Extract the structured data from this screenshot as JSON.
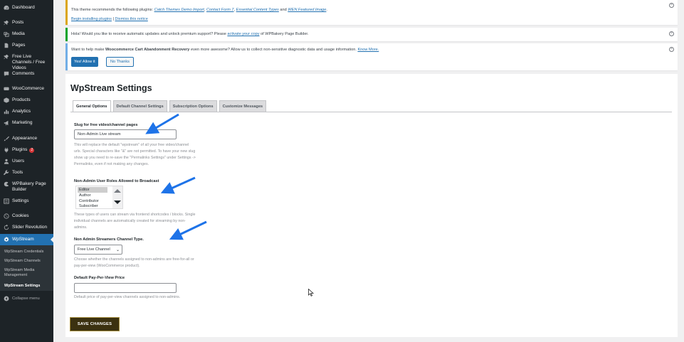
{
  "sidebar": {
    "items": [
      {
        "label": "Dashboard",
        "icon": "dashboard-icon"
      },
      {
        "label": "Posts",
        "icon": "pin-icon"
      },
      {
        "label": "Media",
        "icon": "media-icon"
      },
      {
        "label": "Pages",
        "icon": "page-icon"
      },
      {
        "label": "Free Live Channels / Free Videos",
        "icon": "pin-icon"
      },
      {
        "label": "Comments",
        "icon": "comment-icon"
      },
      {
        "label": "WooCommerce",
        "icon": "woocommerce-icon"
      },
      {
        "label": "Products",
        "icon": "box-icon"
      },
      {
        "label": "Analytics",
        "icon": "bar-chart-icon"
      },
      {
        "label": "Marketing",
        "icon": "megaphone-icon"
      },
      {
        "label": "Appearance",
        "icon": "brush-icon"
      },
      {
        "label": "Plugins",
        "icon": "plug-icon",
        "badge": "2"
      },
      {
        "label": "Users",
        "icon": "user-icon"
      },
      {
        "label": "Tools",
        "icon": "wrench-icon"
      },
      {
        "label": "WPBakery Page Builder",
        "icon": "bakery-icon"
      },
      {
        "label": "Settings",
        "icon": "settings-icon"
      },
      {
        "label": "Cookies",
        "icon": "cookie-icon"
      },
      {
        "label": "Slider Revolution",
        "icon": "refresh-icon"
      },
      {
        "label": "WpStream",
        "icon": "gear-icon"
      }
    ],
    "submenu": [
      {
        "label": "WpStream Credentials"
      },
      {
        "label": "WpStream Channels"
      },
      {
        "label": "WpStream Media Management"
      },
      {
        "label": "WpStream Settings"
      }
    ],
    "collapse_label": "Collapse menu"
  },
  "notices": {
    "theme": {
      "text_before": "This theme recommends the following plugins: ",
      "plugin_1": "Catch Themes Demo Import",
      "sep_1": ", ",
      "plugin_2": "Contact Form 7",
      "sep_2": ", ",
      "plugin_3": "Essential Content Types",
      "sep_3": " and ",
      "plugin_4": "WEN Featured Image",
      "end": ".",
      "begin_link": "Begin installing plugins",
      "pipe": " | ",
      "dismiss_link": "Dismiss this notice"
    },
    "wpbakery": {
      "text_before": "Hola! Would you like to receive automatic updates and unlock premium support? Please ",
      "link": "activate your copy",
      "text_after": " of WPBakery Page Builder."
    },
    "woo": {
      "text_before": "Want to help make ",
      "bold": "Woocommerce Cart Abandonment Recovery",
      "text_after": " even more awesome? Allow us to collect non-sensitive diagnostic data and usage information. ",
      "link": "Know More.",
      "allow_button": "Yes! Allow it",
      "decline_button": "No Thanks"
    },
    "dismiss_icon": "close-circle-icon"
  },
  "settings": {
    "title": "WpStream Settings",
    "tabs": [
      {
        "label": "General Options",
        "active": true
      },
      {
        "label": "Default Channel Settings"
      },
      {
        "label": "Subscription Options"
      },
      {
        "label": "Customize Messages"
      }
    ],
    "slug": {
      "label": "Slug for free video/channel pages",
      "value": "Non-Admin Live stream",
      "help": "This will replace the default \"wpstream\" of all your free video/channel urls. Special characters like \"&\" are not permitted. To have your new slug show up you need to re-save the \"Permalinks Settings\" under Settings -> Permalinks, even if not making any changes."
    },
    "roles": {
      "label": "Non-Admin User Roles Allowed to Broadcast",
      "options": [
        "Editor",
        "Author",
        "Contributor",
        "Subscriber"
      ],
      "selected": "Editor",
      "help": "These types of users can stream via frontend shortcodes / blocks. Single individual channels are automatically created for streaming by non-admins."
    },
    "channel_type": {
      "label": "Non Admin Streamers Channel Type.",
      "value": "Free Live Channel",
      "help": "Choose whether the channels assigned to non-admins are free-for-all or pay-per-view (WooCommerce product)."
    },
    "ppv_price": {
      "label": "Default Pay-Per-View Price",
      "value": "",
      "help": "Default price of pay-per-view channels assigned to non-admins."
    },
    "save_button": "SAVE CHANGES"
  },
  "colors": {
    "sidebar_bg": "#1d2327",
    "active_menu": "#2271b1",
    "annotation_arrow": "#1e73e8",
    "save_button_bg": "#3b3110"
  }
}
